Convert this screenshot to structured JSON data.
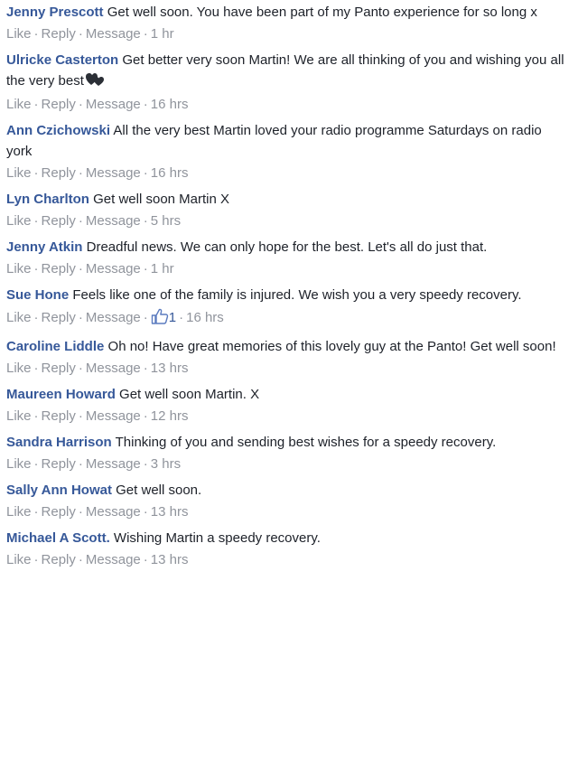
{
  "actions": {
    "like": "Like",
    "reply": "Reply",
    "message": "Message",
    "sep": "·"
  },
  "comments": [
    {
      "name": "Jenny Prescott",
      "text": "Get well soon. You have been part of my Panto experience for so long x",
      "time": "1 hr"
    },
    {
      "name": "Ulricke Casterton",
      "text": "Get better very soon Martin! We are all thinking of you and wishing you all the very best",
      "time": "16 hrs"
    },
    {
      "name": "Ann Czichowski",
      "text": "All the very best Martin loved your radio programme Saturdays on radio york",
      "time": "16 hrs"
    },
    {
      "name": "Lyn Charlton",
      "text": "Get well soon Martin X",
      "time": "5 hrs"
    },
    {
      "name": "Jenny Atkin",
      "text": "Dreadful news. We can only hope for the best. Let's all do just that.",
      "time": "1 hr"
    },
    {
      "name": "Sue Hone",
      "text": "Feels like one of the family is injured. We wish you a very speedy recovery.",
      "time": "16 hrs",
      "likes": "1"
    },
    {
      "name": "Caroline Liddle",
      "text": "Oh no! Have great memories of this lovely guy at the Panto! Get well soon!",
      "time": "13 hrs"
    },
    {
      "name": "Maureen Howard",
      "text": "Get well soon Martin. X",
      "time": "12 hrs"
    },
    {
      "name": "Sandra Harrison",
      "text": "Thinking of you and sending best wishes for a speedy recovery.",
      "time": "3 hrs"
    },
    {
      "name": "Sally Ann Howat",
      "text": "Get well soon.",
      "time": "13 hrs"
    },
    {
      "name": "Michael A Scott.",
      "text": "Wishing Martin a speedy recovery.",
      "time": "13 hrs"
    }
  ],
  "colors": {
    "name": "#365899",
    "meta": "#90949c",
    "text": "#1d2129"
  }
}
